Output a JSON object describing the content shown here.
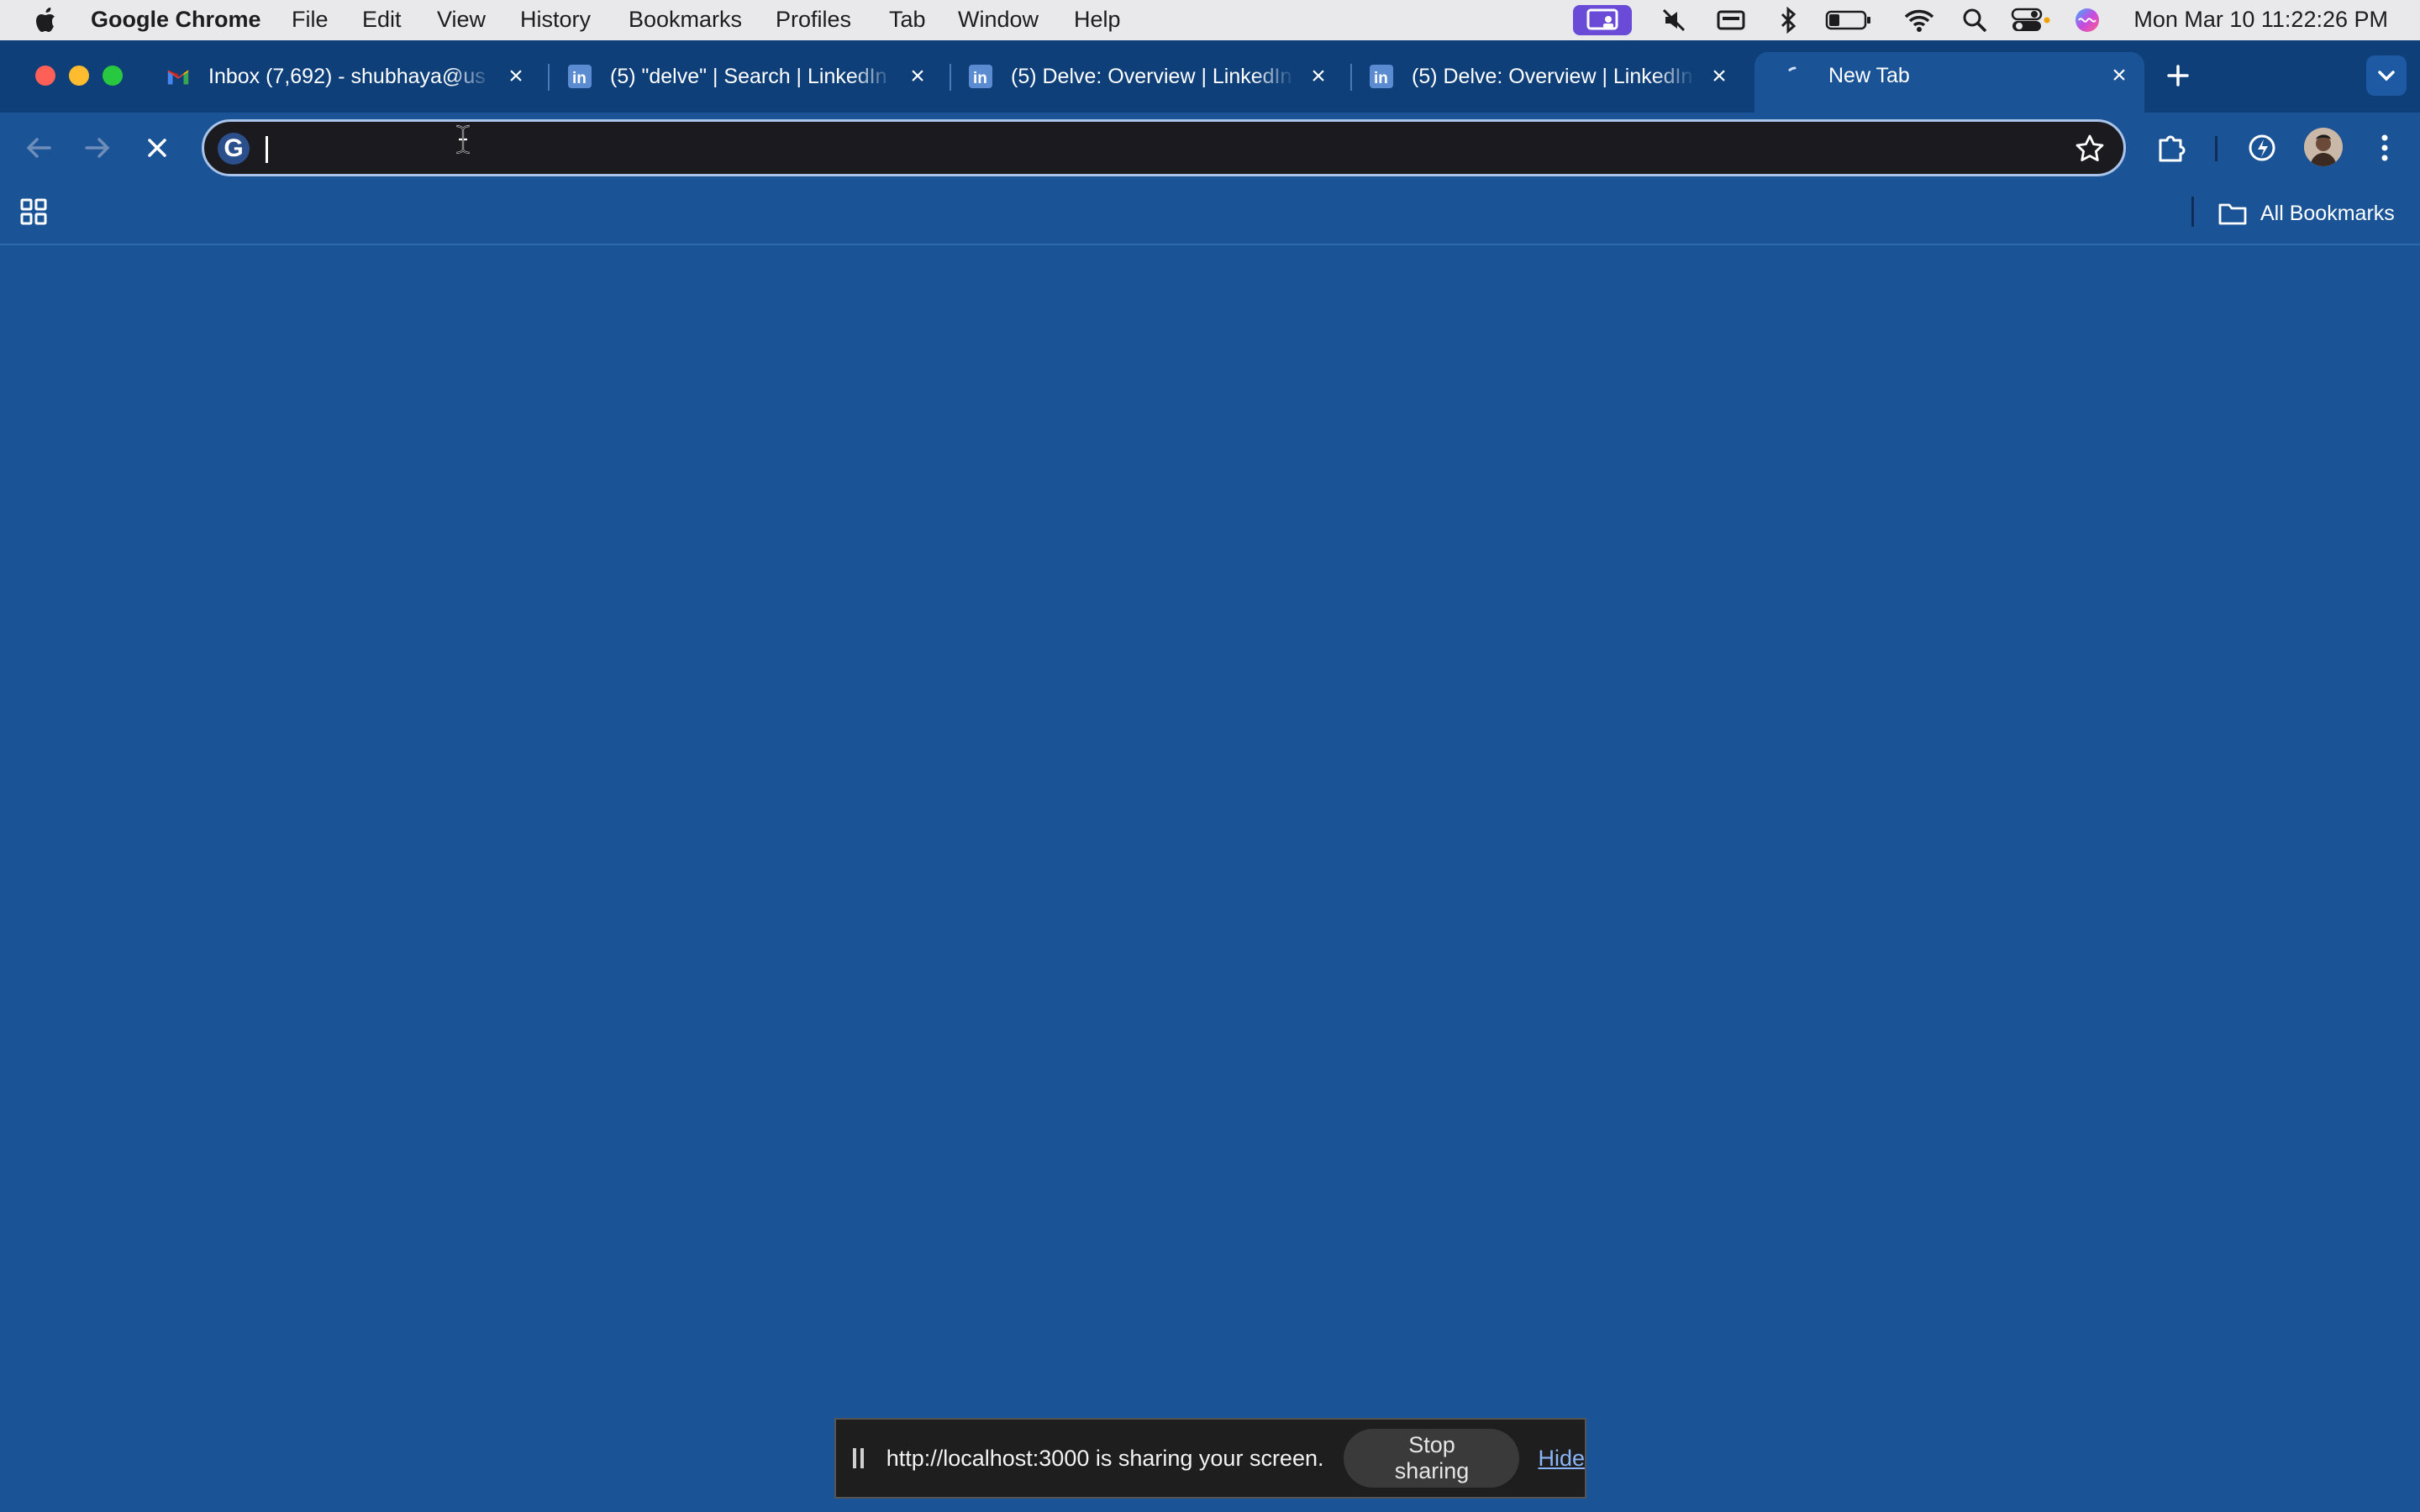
{
  "menubar": {
    "app_name": "Google Chrome",
    "items": [
      "File",
      "Edit",
      "View",
      "History",
      "Bookmarks",
      "Profiles",
      "Tab",
      "Window",
      "Help"
    ],
    "clock": "Mon Mar 10  11:22:26 PM"
  },
  "tabs": [
    {
      "title": "Inbox (7,692) - shubhaya@us",
      "icon": "gmail-icon"
    },
    {
      "title": "(5) \"delve\" | Search | LinkedIn",
      "icon": "linkedin-icon"
    },
    {
      "title": "(5) Delve: Overview | LinkedIn",
      "icon": "linkedin-icon"
    },
    {
      "title": "(5) Delve: Overview | LinkedIn",
      "icon": "linkedin-icon"
    },
    {
      "title": "New Tab",
      "icon": "loading-spinner-icon",
      "active": true
    }
  ],
  "omnibox": {
    "value": "",
    "placeholder": ""
  },
  "bookmarks": {
    "all_label": "All Bookmarks"
  },
  "sharebar": {
    "message": "http://localhost:3000 is sharing your screen.",
    "stop_label": "Stop sharing",
    "hide_label": "Hide"
  },
  "colors": {
    "page_bg": "#1A5396",
    "tabstrip_bg": "#0E3F79",
    "omnibox_bg": "#1B1B1F"
  }
}
